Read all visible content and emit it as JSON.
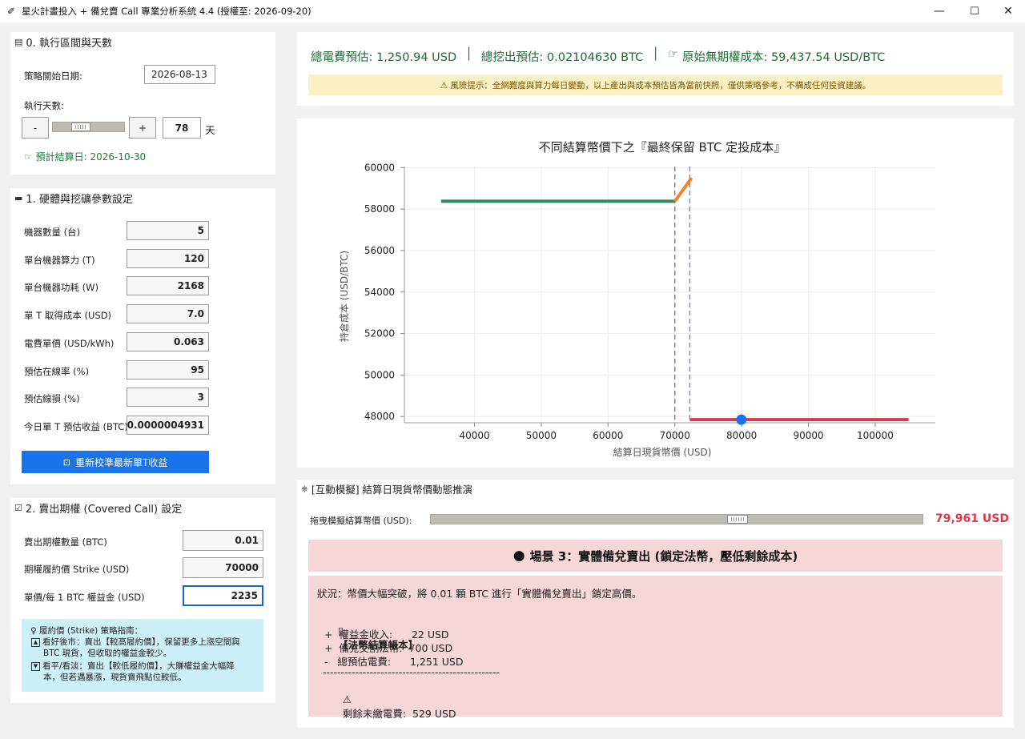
{
  "window": {
    "title": "星火計畫投入 + 備兌賣 Call 專業分析系統 4.4 (授權至: 2026-09-20)",
    "minimize": "—",
    "maximize": "☐",
    "close": "✕"
  },
  "section0": {
    "title": "0. 執行區間與天數",
    "start_label": "策略開始日期:",
    "start_value": "2026-08-13",
    "days_label": "執行天數:",
    "minus": "-",
    "plus": "+",
    "days_value": "78",
    "days_unit": "天",
    "days_slider_fraction": 0.35,
    "settle_label": "預計結算日: 2026-10-30"
  },
  "section1": {
    "title": "1. 硬體與挖礦參數設定",
    "rows": [
      {
        "label": "機器數量 (台)",
        "value": "5"
      },
      {
        "label": "單台機器算力 (T)",
        "value": "120"
      },
      {
        "label": "單台機器功耗 (W)",
        "value": "2168"
      },
      {
        "label": "單 T 取得成本 (USD)",
        "value": "7.0"
      },
      {
        "label": "電費單價 (USD/kWh)",
        "value": "0.063"
      },
      {
        "label": "預估在線率 (%)",
        "value": "95"
      },
      {
        "label": "預估線損 (%)",
        "value": "3"
      },
      {
        "label": "今日單 T 預估收益 (BTC)",
        "value": "0.0000004931"
      }
    ],
    "recalibrate_button": "重新校準最新單T收益"
  },
  "section2": {
    "title": "2. 賣出期權 (Covered Call) 設定",
    "rows": [
      {
        "label": "賣出期權數量 (BTC)",
        "value": "0.01"
      },
      {
        "label": "期權履約價 Strike (USD)",
        "value": "70000"
      },
      {
        "label": "單價/每 1 BTC 權益金 (USD)",
        "value": "2235"
      }
    ],
    "guide": {
      "title": "履約價 (Strike) 策略指南：",
      "line1": "看好後市：賣出【較高履約價】，保留更多上漲空間與",
      "line1b": "BTC 現貨，但收取的權益金較少。",
      "line2": "看平/看淡：賣出【較低履約價】，大賺權益金大幅降",
      "line2b": "本，但若遇暴漲，現貨賣飛點位較低。"
    }
  },
  "summary": {
    "power": "總電費預估: 1,250.94 USD",
    "sep1": "│",
    "mined": "總挖出預估: 0.02104630 BTC",
    "sep2": "│",
    "cost": "原始無期權成本: 59,437.54 USD/BTC",
    "warning": "⚠ 風險提示：全網難度與算力每日變動，以上產出與成本預估皆為當前快照，僅供策略參考，不構成任何投資建議。"
  },
  "chart_data": {
    "type": "line",
    "title": "不同結算幣價下之『最終保留 BTC 定投成本』",
    "xlabel": "結算日現貨幣價 (USD)",
    "ylabel": "持倉成本 (USD/BTC)",
    "xlim": [
      29500,
      109000
    ],
    "ylim": [
      47700,
      60050
    ],
    "xticks": [
      40000,
      50000,
      60000,
      70000,
      80000,
      90000,
      100000
    ],
    "yticks": [
      48000,
      50000,
      52000,
      54000,
      56000,
      58000,
      60000
    ],
    "grid": true,
    "series": [
      {
        "color": "#2e8b57",
        "points": [
          [
            35000,
            58375
          ],
          [
            70000,
            58375
          ]
        ]
      },
      {
        "color": "#f0822a",
        "points": [
          [
            70000,
            58375
          ],
          [
            72500,
            59500
          ]
        ]
      },
      {
        "color": "#d93a4a",
        "points": [
          [
            72235,
            47850
          ],
          [
            105000,
            47850
          ]
        ]
      }
    ],
    "vlines": [
      {
        "x": 70000,
        "color": "#888888"
      },
      {
        "x": 72235,
        "color": "#8888aa"
      }
    ],
    "marker": {
      "x": 79961,
      "y": 47850,
      "color": "#1a73e8"
    }
  },
  "simulation": {
    "title": "[互動模擬] 結算日現貨幣價動態推演",
    "slider_label": "拖曳模擬結算幣價 (USD):",
    "slider_fraction": 0.63,
    "price": "79,961 USD",
    "scenario_title": "場景 3：實體備兌賣出 (鎖定法幣，壓低剩餘成本)",
    "status": "狀況：幣價大幅突破，將 0.01 顆 BTC 進行「實體備兌賣出」鎖定高價。",
    "ledger_title": "【法幣結算帳本】",
    "ledger": [
      "+  權益金收入:      22 USD",
      "+  備兌交割法幣:  700 USD",
      "-   總預估電費:      1,251 USD"
    ],
    "divider": "-------------------------------------------------",
    "remaining": "剩餘未繳電費:  529 USD"
  }
}
